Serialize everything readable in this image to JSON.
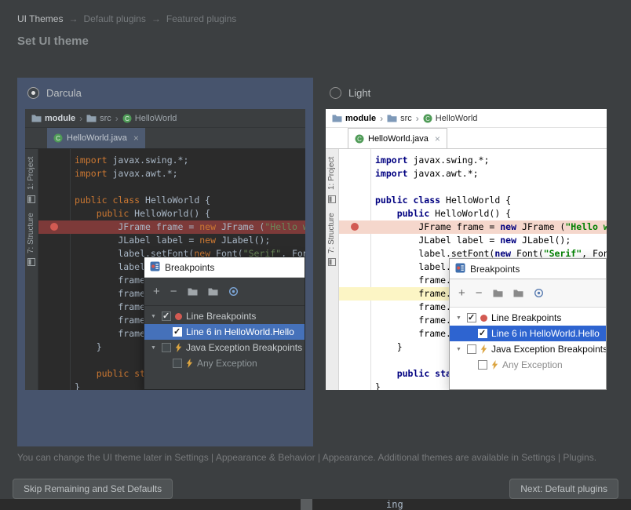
{
  "breadcrumb": {
    "separator": "→",
    "items": [
      {
        "label": "UI Themes",
        "active": true
      },
      {
        "label": "Default plugins",
        "active": false
      },
      {
        "label": "Featured plugins",
        "active": false
      }
    ]
  },
  "page_title": "Set UI theme",
  "themes": [
    {
      "name": "Darcula",
      "selected": true
    },
    {
      "name": "Light",
      "selected": false
    }
  ],
  "colors": {
    "darcula_selected_panel": "#47546d",
    "darcula_selection_blue": "#4571ba",
    "light_selection_blue": "#2e64d0",
    "breakpoint_red": "#d25a52",
    "darcula_editor_bg": "#2b2b2b",
    "light_editor_bg": "#ffffff",
    "darcula_keyword": "#cc7832",
    "light_keyword": "#000080"
  },
  "preview": {
    "crumb_separator": "›",
    "breadcrumb_bar": [
      {
        "label": "module",
        "icon": "module-folder-icon",
        "bold": true
      },
      {
        "label": "src",
        "icon": "folder-icon",
        "bold": false
      },
      {
        "label": "HelloWorld",
        "icon": "class-icon",
        "bold": false
      }
    ],
    "tab": {
      "label": "HelloWorld.java",
      "icon": "java-class-icon",
      "close_icon": "close-tab-icon"
    },
    "tool_window_bar": [
      {
        "label": "1: Project",
        "icon": "project-tool-window-icon"
      },
      {
        "label": "7: Structure",
        "icon": "structure-tool-window-icon"
      }
    ],
    "code_lines": [
      {
        "tokens": [
          {
            "t": "import",
            "c": "kw"
          },
          {
            "t": " javax.swing.*;",
            "c": "pl"
          }
        ]
      },
      {
        "tokens": [
          {
            "t": "import",
            "c": "kw"
          },
          {
            "t": " javax.awt.*;",
            "c": "pl"
          }
        ]
      },
      {
        "tokens": []
      },
      {
        "tokens": [
          {
            "t": "public class ",
            "c": "kw"
          },
          {
            "t": "HelloWorld {",
            "c": "pl"
          }
        ]
      },
      {
        "tokens": [
          {
            "t": "    ",
            "c": "pl"
          },
          {
            "t": "public",
            "c": "kw"
          },
          {
            "t": " HelloWorld() {",
            "c": "pl"
          }
        ]
      },
      {
        "tokens": [
          {
            "t": "        JFrame frame = ",
            "c": "pl"
          },
          {
            "t": "new",
            "c": "kw"
          },
          {
            "t": " JFrame (",
            "c": "pl"
          },
          {
            "t": "\"Hello wo",
            "c": "str"
          }
        ],
        "breakpoint": true
      },
      {
        "tokens": [
          {
            "t": "        JLabel label = ",
            "c": "pl"
          },
          {
            "t": "new",
            "c": "kw"
          },
          {
            "t": " JLabel();",
            "c": "pl"
          }
        ]
      },
      {
        "tokens": [
          {
            "t": "        label.setFont(",
            "c": "pl"
          },
          {
            "t": "new",
            "c": "kw"
          },
          {
            "t": " Font(",
            "c": "pl"
          },
          {
            "t": "\"Serif\"",
            "c": "str"
          },
          {
            "t": ", Font",
            "c": "pl"
          }
        ]
      },
      {
        "tokens": [
          {
            "t": "        label.",
            "c": "pl"
          }
        ]
      },
      {
        "tokens": [
          {
            "t": "        frame.",
            "c": "pl"
          }
        ]
      },
      {
        "tokens": [
          {
            "t": "        frame.",
            "c": "pl"
          }
        ],
        "current": true
      },
      {
        "tokens": [
          {
            "t": "        frame.",
            "c": "pl"
          }
        ]
      },
      {
        "tokens": [
          {
            "t": "        frame.",
            "c": "pl"
          }
        ]
      },
      {
        "tokens": [
          {
            "t": "        frame.",
            "c": "pl"
          }
        ]
      },
      {
        "tokens": [
          {
            "t": "    }",
            "c": "pl"
          }
        ]
      },
      {
        "tokens": []
      },
      {
        "tokens": [
          {
            "t": "    ",
            "c": "pl"
          },
          {
            "t": "public sta",
            "c": "kw"
          }
        ]
      },
      {
        "tokens": [
          {
            "t": "}",
            "c": "pl"
          }
        ]
      }
    ],
    "breakpoints_dialog": {
      "title": "Breakpoints",
      "title_icon": "breakpoints-dialog-icon",
      "toolbar_icons": [
        "add-icon",
        "remove-icon",
        "group-by-icon",
        "move-to-group-icon",
        "goto-source-icon"
      ],
      "tree": [
        {
          "label": "Line Breakpoints",
          "icon": "line-breakpoint-icon",
          "checked": true,
          "expandable": true,
          "level": 0,
          "selected": false,
          "muted": false
        },
        {
          "label": "Line 6 in HelloWorld.Hello",
          "icon": null,
          "checked": true,
          "expandable": false,
          "level": 1,
          "selected": true,
          "muted": false
        },
        {
          "label": "Java Exception Breakpoints",
          "icon": "exception-breakpoint-icon",
          "checked": false,
          "expandable": true,
          "level": 0,
          "selected": false,
          "muted": false
        },
        {
          "label": "Any Exception",
          "icon": "exception-breakpoint-icon",
          "checked": false,
          "expandable": false,
          "level": 1,
          "selected": false,
          "muted": true
        }
      ]
    }
  },
  "footer_note": "You can change the UI theme later in Settings | Appearance & Behavior | Appearance. Additional themes are available in Settings | Plugins.",
  "buttons": {
    "skip": "Skip Remaining and Set Defaults",
    "next": "Next: Default plugins"
  },
  "background_window": {
    "fragment_text": "ing"
  }
}
